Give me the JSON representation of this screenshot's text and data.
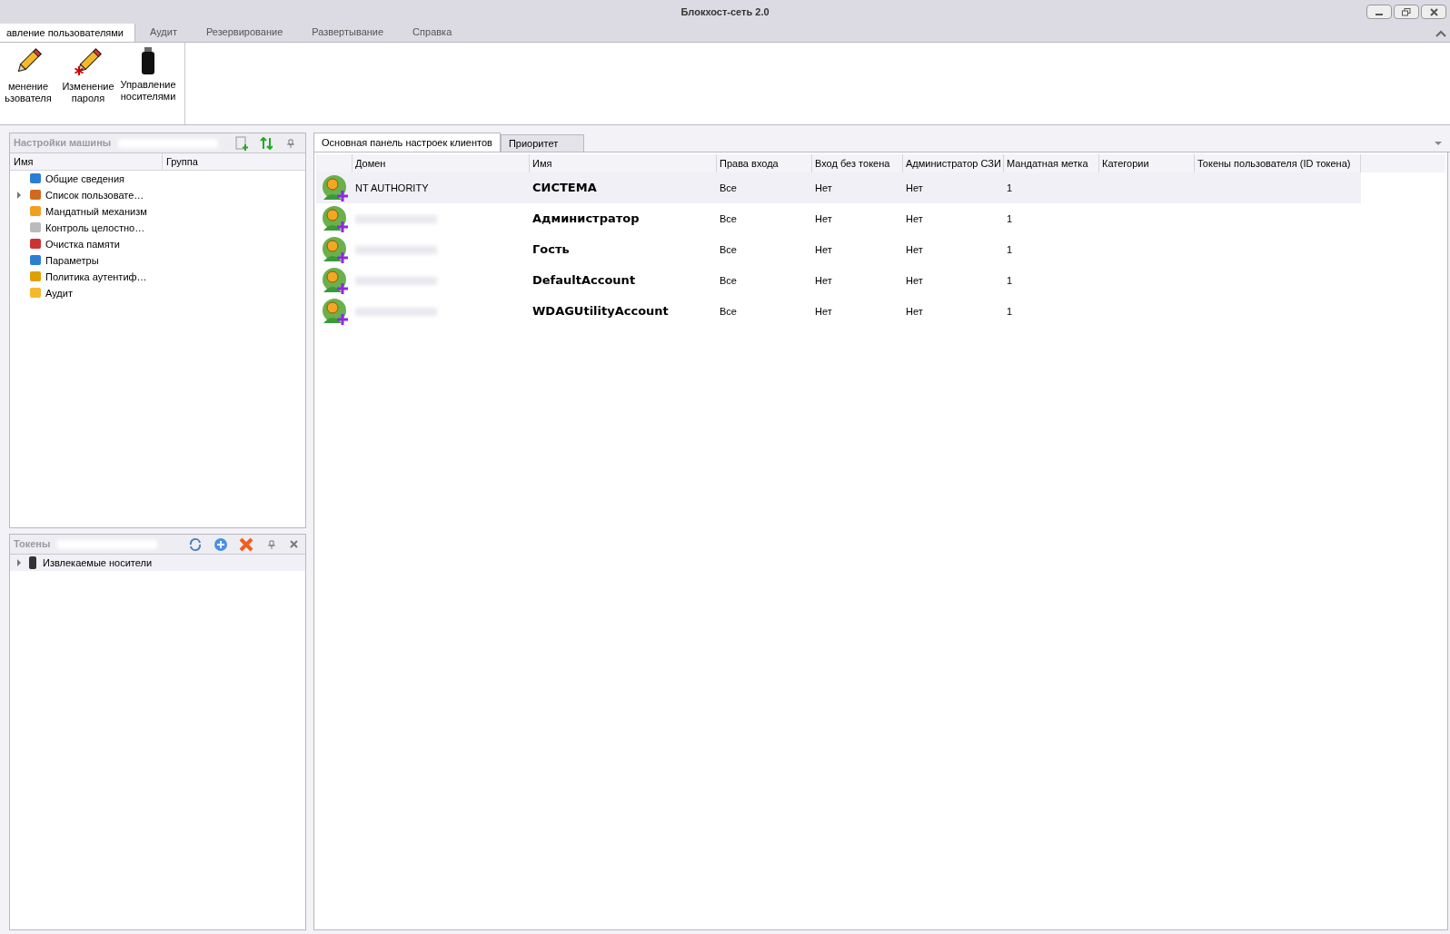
{
  "window": {
    "title": "Блокхост-сеть 2.0"
  },
  "ribbon_tabs": [
    {
      "label": "авление пользователями",
      "selected": true
    },
    {
      "label": "Аудит",
      "selected": false
    },
    {
      "label": "Резервирование",
      "selected": false
    },
    {
      "label": "Развертывание",
      "selected": false
    },
    {
      "label": "Справка",
      "selected": false
    }
  ],
  "ribbon_buttons": [
    {
      "lines": [
        "менение",
        "ьзователя"
      ]
    },
    {
      "lines": [
        "Изменение",
        "пароля"
      ]
    },
    {
      "lines": [
        "Управление",
        "носителями"
      ]
    }
  ],
  "machine_panel": {
    "title": "Настройки машины",
    "columns": [
      "Имя",
      "Группа"
    ],
    "items": [
      {
        "label": "Общие сведения",
        "expandable": false
      },
      {
        "label": "Список пользовате…",
        "expandable": true
      },
      {
        "label": "Мандатный механизм",
        "expandable": false
      },
      {
        "label": "Контроль целостно…",
        "expandable": false
      },
      {
        "label": "Очистка памяти",
        "expandable": false
      },
      {
        "label": "Параметры",
        "expandable": false
      },
      {
        "label": "Политика аутентиф…",
        "expandable": false
      },
      {
        "label": "Аудит",
        "expandable": false
      }
    ]
  },
  "tokens_panel": {
    "title": "Токены",
    "items": [
      {
        "label": "Извлекаемые носители",
        "expandable": true
      }
    ]
  },
  "content_tabs": [
    {
      "label": "Основная панель настроек клиентов",
      "selected": true
    },
    {
      "label": "Приоритет",
      "selected": false
    }
  ],
  "table": {
    "columns": [
      "Домен",
      "Имя",
      "Права входа",
      "Вход без токена",
      "Администратор СЗИ",
      "Мандатная метка",
      "Категории",
      "Токены пользователя (ID токена)"
    ],
    "rows": [
      {
        "domain": "NT AUTHORITY",
        "name": "СИСТЕМА",
        "login": "Все",
        "no_token": "Нет",
        "admin": "Нет",
        "label": "1",
        "selected": true
      },
      {
        "name": "Администратор",
        "login": "Все",
        "no_token": "Нет",
        "admin": "Нет",
        "label": "1",
        "selected": false
      },
      {
        "name": "Гость",
        "login": "Все",
        "no_token": "Нет",
        "admin": "Нет",
        "label": "1",
        "selected": false
      },
      {
        "name": "DefaultAccount",
        "login": "Все",
        "no_token": "Нет",
        "admin": "Нет",
        "label": "1",
        "selected": false
      },
      {
        "name": "WDAGUtilityAccount",
        "login": "Все",
        "no_token": "Нет",
        "admin": "Нет",
        "label": "1",
        "selected": false
      }
    ]
  }
}
